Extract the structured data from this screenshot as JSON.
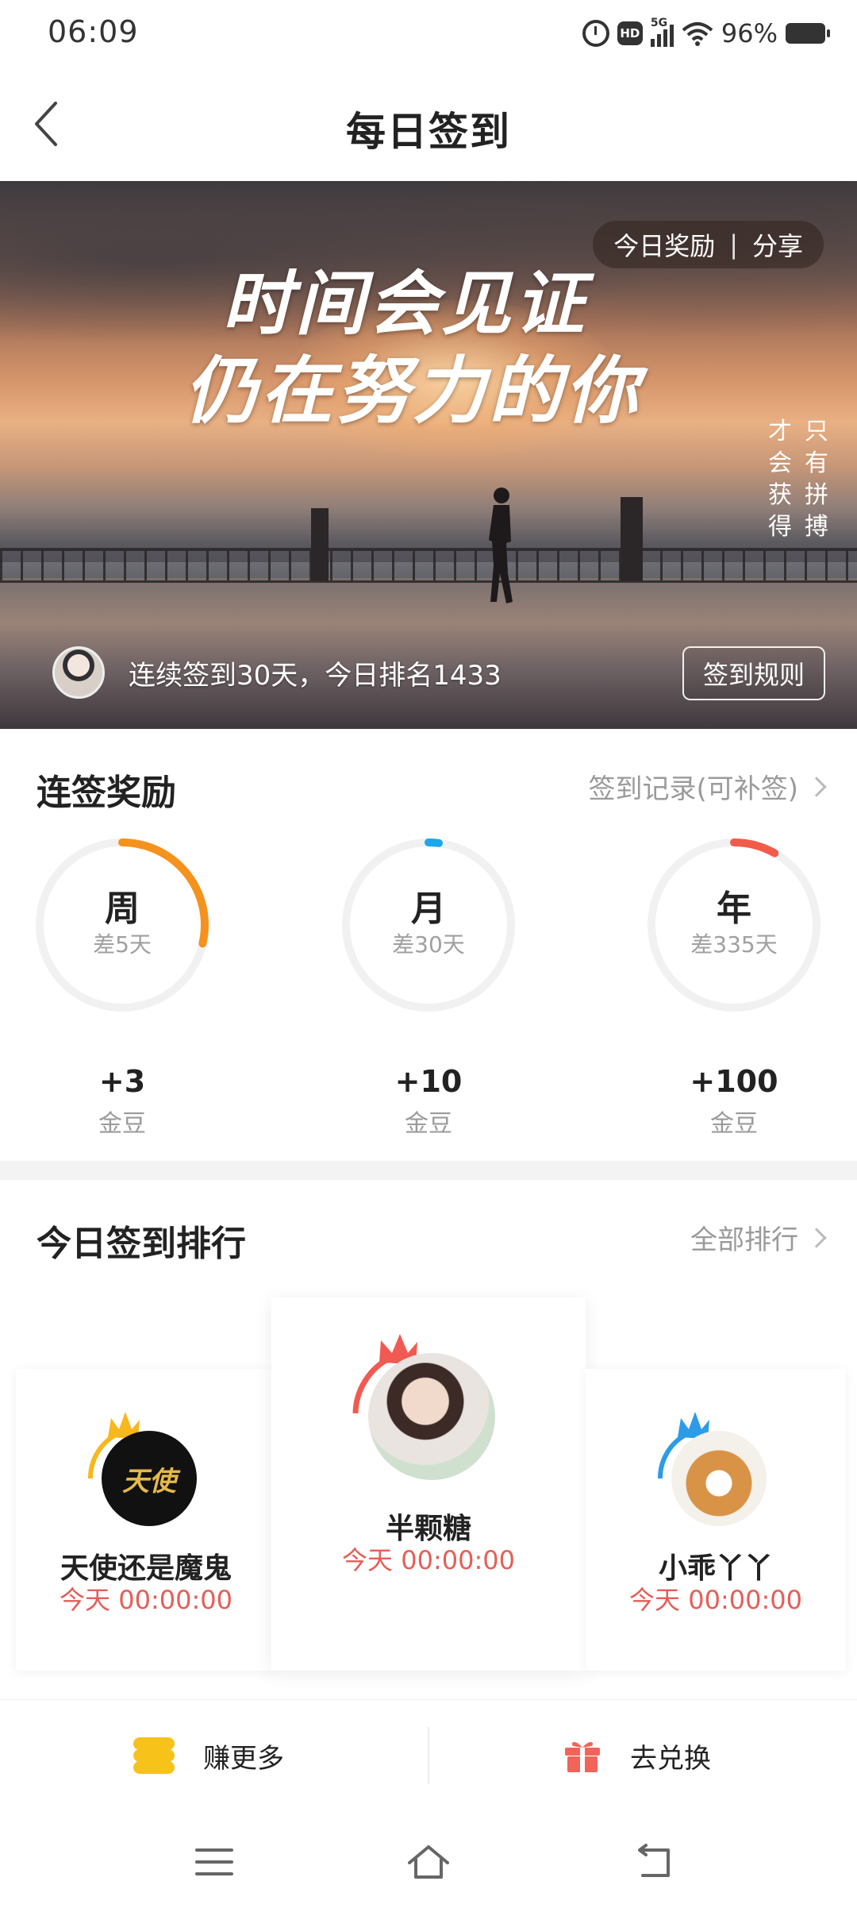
{
  "status_bar": {
    "time": "06:09",
    "network": "5G",
    "hd_label": "HD",
    "battery": "96%"
  },
  "header": {
    "title": "每日签到"
  },
  "hero": {
    "quote_line1": "时间会见证",
    "quote_line2": "仍在努力的你",
    "vertical_col1": "只有拼搏",
    "vertical_col2": "才会获得",
    "pill_reward": "今日奖励",
    "pill_sep": "|",
    "pill_share": "分享",
    "streak_text": "连续签到30天，今日排名1433",
    "rules_button": "签到规则"
  },
  "streak_rewards": {
    "title": "连签奖励",
    "record_link": "签到记录(可补签)",
    "items": [
      {
        "label": "周",
        "remaining": "差5天",
        "bonus": "+3",
        "unit": "金豆",
        "progress": 0.286,
        "color": "#f5921e"
      },
      {
        "label": "月",
        "remaining": "差30天",
        "bonus": "+10",
        "unit": "金豆",
        "progress": 0.02,
        "color": "#1ea7e8"
      },
      {
        "label": "年",
        "remaining": "差335天",
        "bonus": "+100",
        "unit": "金豆",
        "progress": 0.082,
        "color": "#f25b4a"
      }
    ]
  },
  "ranking": {
    "title": "今日签到排行",
    "all_link": "全部排行",
    "first": {
      "name": "半颗糖",
      "time": "今天 00:00:00",
      "crown_color": "#f05a52"
    },
    "second": {
      "name": "天使还是魔鬼",
      "time": "今天 00:00:00",
      "crown_color": "#f6b81d",
      "avatar_text": "天使"
    },
    "third": {
      "name": "小乖丫丫",
      "time": "今天 00:00:00",
      "crown_color": "#2c9be8"
    }
  },
  "actions": {
    "earn_label": "赚更多",
    "redeem_label": "去兑换"
  },
  "colors": {
    "accent_red": "#e55e57",
    "coin_yellow": "#f7c21a",
    "gift_red": "#f2635a",
    "ring_track": "#f1f1f1"
  }
}
